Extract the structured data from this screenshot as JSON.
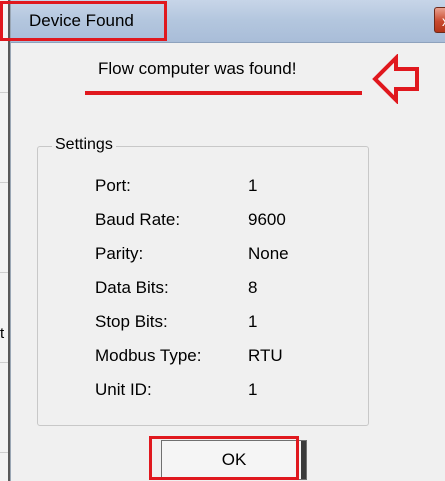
{
  "window": {
    "title": "Device Found",
    "close_label": "x"
  },
  "message": "Flow computer was found!",
  "settings": {
    "legend": "Settings",
    "rows": [
      {
        "label": "Port:",
        "value": "1"
      },
      {
        "label": "Baud Rate:",
        "value": "9600"
      },
      {
        "label": "Parity:",
        "value": "None"
      },
      {
        "label": "Data Bits:",
        "value": "8"
      },
      {
        "label": "Stop Bits:",
        "value": "1"
      },
      {
        "label": "Modbus Type:",
        "value": "RTU"
      },
      {
        "label": "Unit ID:",
        "value": "1"
      }
    ]
  },
  "buttons": {
    "ok_label": "OK"
  },
  "background": {
    "edge_glyph": "t"
  },
  "colors": {
    "highlight": "#e0181e",
    "title_bar": "#b3c6de",
    "dialog_bg": "#f0f0f0"
  }
}
